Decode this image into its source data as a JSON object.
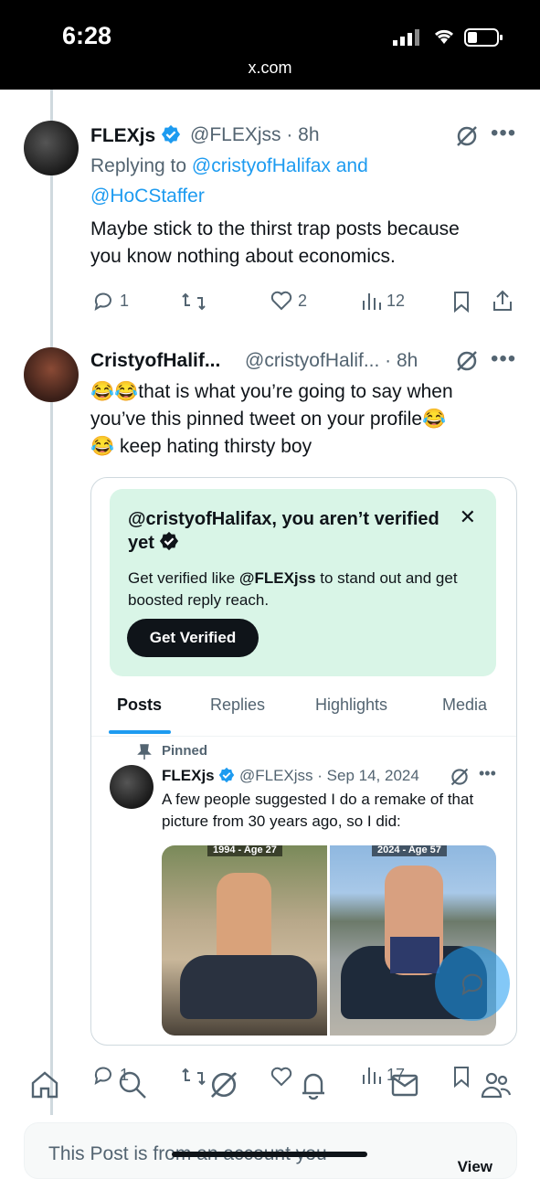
{
  "status_bar": {
    "time": "6:28",
    "url": "x.com"
  },
  "reply1": {
    "name": "FLEXjs",
    "handle": "@FLEXjss · 8h",
    "replying_prefix": "Replying to ",
    "replying_to": "@cristyofHalifax and",
    "replying_to2": "@HoCStaffer",
    "text_line1": "Maybe stick to the thirst trap posts because",
    "text_line2": "you know nothing about economics.",
    "replies": "1",
    "likes": "2",
    "views": "12"
  },
  "reply2": {
    "name": "CristyofHalif...",
    "handle": "@cristyofHalif... · 8h",
    "text_line1": "😂😂that is what you’re going to say when",
    "text_line2": "you’ve this pinned tweet on your profile😂",
    "text_line3": "😂 keep hating thirsty boy"
  },
  "embed": {
    "promo_title": "@cristyofHalifax, you aren’t verified yet",
    "promo_text_prefix": "Get verified like ",
    "promo_text_handle": "@FLEXjss",
    "promo_text_suffix": " to stand out and get boosted reply reach.",
    "promo_button": "Get Verified",
    "tabs": [
      "Posts",
      "Replies",
      "Highlights",
      "Media"
    ],
    "pinned_label": "Pinned",
    "post_name": "FLEXjs",
    "post_handle": "@FLEXjss · Sep 14, 2024",
    "post_text": "A few people suggested I do a remake of that picture from 30 years ago, so I did:",
    "photo1_label": "1994 - Age 27",
    "photo2_label": "2024 - Age 57"
  },
  "action_bar2": {
    "replies": "1",
    "views": "17"
  },
  "banner": {
    "text": "This Post is from an account you",
    "view": "View"
  },
  "colors": {
    "accent": "#1d9bf0",
    "promo_bg": "#d9f5e7",
    "text": "#0f1419",
    "muted": "#536471"
  }
}
